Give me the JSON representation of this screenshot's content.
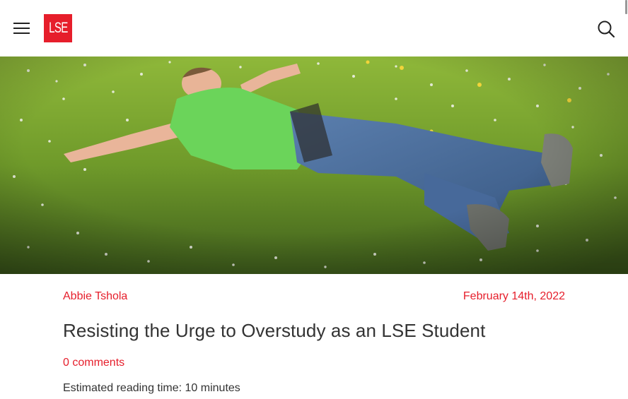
{
  "header": {
    "logo_text": "LSE",
    "menu_icon": "hamburger-menu-icon",
    "search_icon": "search-icon",
    "brand_color": "#e61e2b"
  },
  "hero": {
    "image_subject": "man-lying-on-grass-with-daisies-photo"
  },
  "article": {
    "author": "Abbie Tshola",
    "date": "February 14th, 2022",
    "title": "Resisting the Urge to Overstudy as an LSE Student",
    "comments": "0 comments",
    "reading_time": "Estimated reading time: 10 minutes"
  }
}
